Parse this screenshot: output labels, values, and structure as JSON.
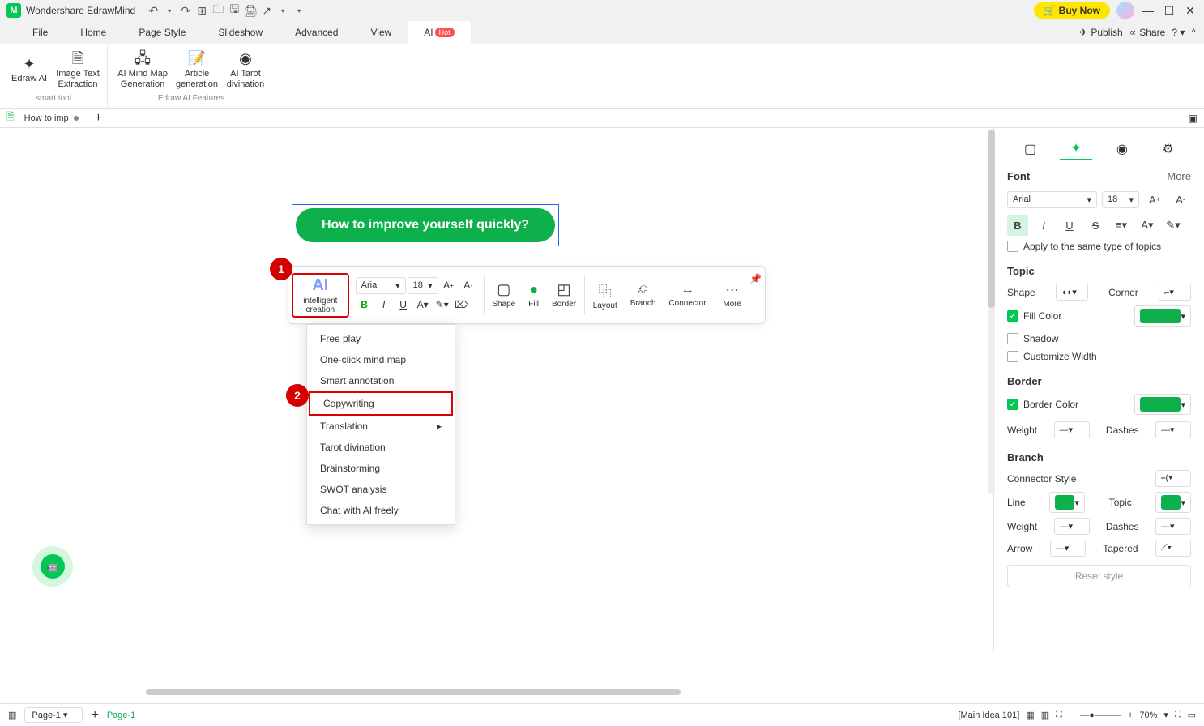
{
  "title": {
    "app": "Wondershare EdrawMind",
    "buy": "Buy Now"
  },
  "menu": {
    "items": [
      "File",
      "Home",
      "Page Style",
      "Slideshow",
      "Advanced",
      "View"
    ],
    "ai": "AI",
    "hot": "Hot",
    "publish": "Publish",
    "share": "Share"
  },
  "ribbon": {
    "g1_label": "smart tool",
    "g2_label": "Edraw AI Features",
    "edraw_ai": "Edraw AI",
    "img_text": "Image Text Extraction",
    "mindmap": "AI Mind Map Generation",
    "article": "Article generation",
    "tarot": "AI Tarot divination"
  },
  "doc": {
    "tab": "How to imp"
  },
  "node_text": "How to improve yourself quickly?",
  "callouts": {
    "one": "1",
    "two": "2"
  },
  "float": {
    "ai": "AI",
    "ai_lbl": "intelligent creation",
    "font": "Arial",
    "size": "18",
    "shape": "Shape",
    "fill": "Fill",
    "border": "Border",
    "layout": "Layout",
    "branch": "Branch",
    "connector": "Connector",
    "more": "More"
  },
  "ctx": {
    "items": [
      "Free play",
      "One-click mind map",
      "Smart annotation",
      "Copywriting",
      "Translation",
      "Tarot divination",
      "Brainstorming",
      "SWOT analysis",
      "Chat with AI freely"
    ],
    "boxed_index": 3,
    "submenu_index": 4
  },
  "panel": {
    "font": "Font",
    "more": "More",
    "font_name": "Arial",
    "font_size": "18",
    "apply_same": "Apply to the same type of topics",
    "topic": "Topic",
    "shape": "Shape",
    "corner": "Corner",
    "fill_color": "Fill Color",
    "shadow": "Shadow",
    "custom_w": "Customize Width",
    "border": "Border",
    "border_color": "Border Color",
    "weight": "Weight",
    "dashes": "Dashes",
    "branch": "Branch",
    "conn_style": "Connector Style",
    "line": "Line",
    "topic_l": "Topic",
    "arrow": "Arrow",
    "tapered": "Tapered",
    "reset": "Reset style"
  },
  "status": {
    "page": "Page-1",
    "page_link": "Page-1",
    "main_idea": "[Main Idea 101]",
    "zoom": "70%"
  }
}
